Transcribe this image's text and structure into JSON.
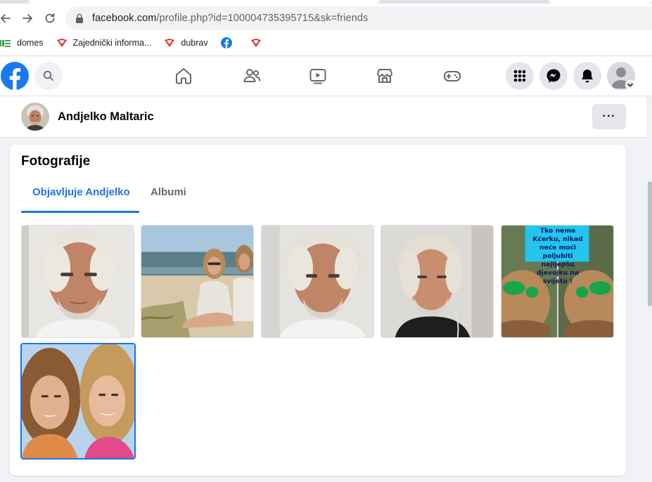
{
  "browser": {
    "url_host": "facebook.com",
    "url_path": "/profile.php?id=100004735395715&sk=friends",
    "bookmarks": [
      {
        "label": "domes",
        "icon": "domes-favicon"
      },
      {
        "label": "Zajednički informa...",
        "icon": "red-ribbon-favicon"
      },
      {
        "label": "dubrav",
        "icon": "red-ribbon-favicon"
      },
      {
        "label": "",
        "icon": "facebook-favicon"
      },
      {
        "label": "",
        "icon": "red-ribbon-favicon"
      }
    ]
  },
  "header": {
    "nav_icons": [
      "home-icon",
      "friends-icon",
      "watch-icon",
      "marketplace-icon",
      "gaming-icon"
    ],
    "right_icons": [
      "menu-grid-icon",
      "messenger-icon",
      "notifications-icon",
      "account-avatar"
    ]
  },
  "profile": {
    "name": "Andjelko Maltaric",
    "more_label": "···"
  },
  "photos_card": {
    "title": "Fotografije",
    "tabs": [
      {
        "label": "Objavljuje Andjelko",
        "active": true
      },
      {
        "label": "Albumi",
        "active": false
      }
    ],
    "meme_caption": "Tko nema Kćerku, nikad neće moći poljubiti najljepšu djevojku na svijetu !",
    "photo_count": 6
  },
  "colors": {
    "facebook_blue": "#1877f2",
    "tab_active": "#1b74e4",
    "page_bg": "#f0f2f5"
  }
}
